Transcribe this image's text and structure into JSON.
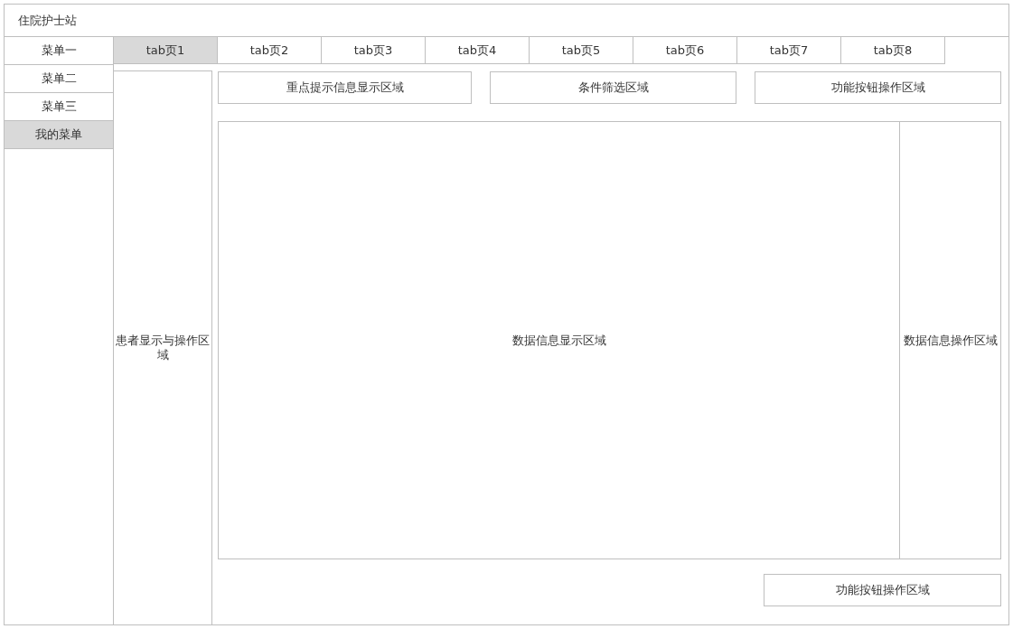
{
  "window": {
    "title": "住院护士站"
  },
  "sidebar": {
    "items": [
      {
        "label": "菜单一",
        "selected": false
      },
      {
        "label": "菜单二",
        "selected": false
      },
      {
        "label": "菜单三",
        "selected": false
      },
      {
        "label": "我的菜单",
        "selected": true
      }
    ]
  },
  "tabs": [
    {
      "label": "tab页1",
      "selected": true
    },
    {
      "label": "tab页2",
      "selected": false
    },
    {
      "label": "tab页3",
      "selected": false
    },
    {
      "label": "tab页4",
      "selected": false
    },
    {
      "label": "tab页5",
      "selected": false
    },
    {
      "label": "tab页6",
      "selected": false
    },
    {
      "label": "tab页7",
      "selected": false
    },
    {
      "label": "tab页8",
      "selected": false
    }
  ],
  "patient_panel": {
    "label": "患者显示与操作区域"
  },
  "top_areas": [
    "重点提示信息显示区域",
    "条件筛选区域",
    "功能按钮操作区域"
  ],
  "data_display": {
    "label": "数据信息显示区域"
  },
  "data_operations": {
    "label": "数据信息操作区域"
  },
  "bottom_area": {
    "label": "功能按钮操作区域"
  }
}
